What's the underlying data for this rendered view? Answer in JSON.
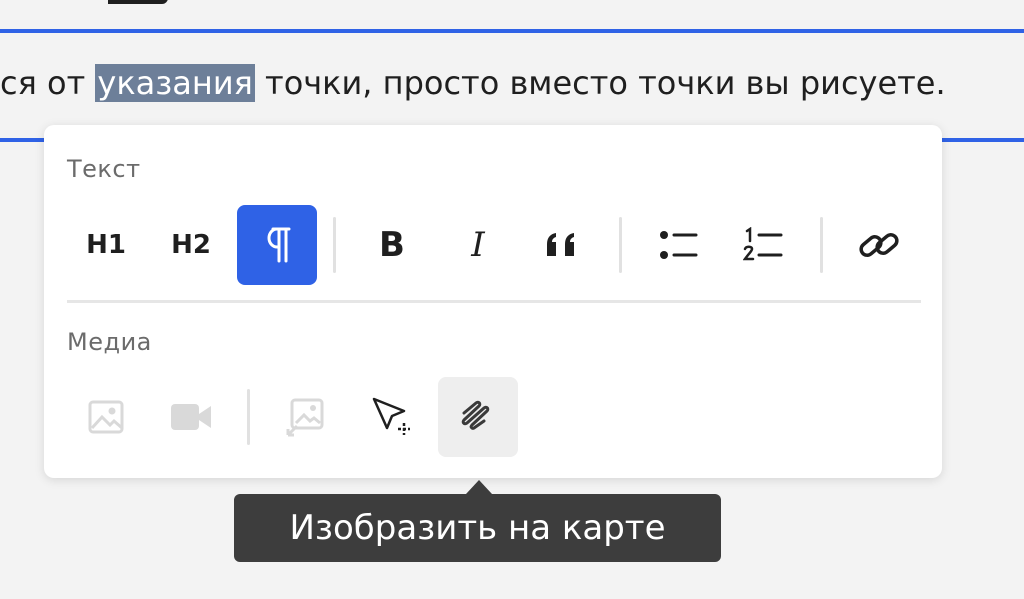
{
  "document": {
    "text_before": "ся от ",
    "selected_word": "указания",
    "text_after": " точки, просто вместо точки вы рисуете."
  },
  "toolbar": {
    "text_section_title": "Текст",
    "media_section_title": "Медиа",
    "h1_label": "H1",
    "h2_label": "H2",
    "bold_label": "B",
    "italic_label": "I",
    "paragraph_active": true,
    "draw_on_map_hover": true
  },
  "tooltip": {
    "label": "Изобразить на карте"
  },
  "colors": {
    "accent": "#2f62e6",
    "selection": "#6d7f99",
    "tooltip_bg": "#3d3d3d",
    "disabled_icon": "#d9d9d9"
  },
  "icons": {
    "paragraph": "pilcrow-icon",
    "quote": "quote-icon",
    "bullet_list": "bullet-list-icon",
    "numbered_list": "numbered-list-icon",
    "link": "link-icon",
    "image": "image-icon",
    "video": "video-camera-icon",
    "image_point": "image-pointer-icon",
    "point_select": "cursor-plus-icon",
    "draw_on_map": "draw-line-icon"
  }
}
